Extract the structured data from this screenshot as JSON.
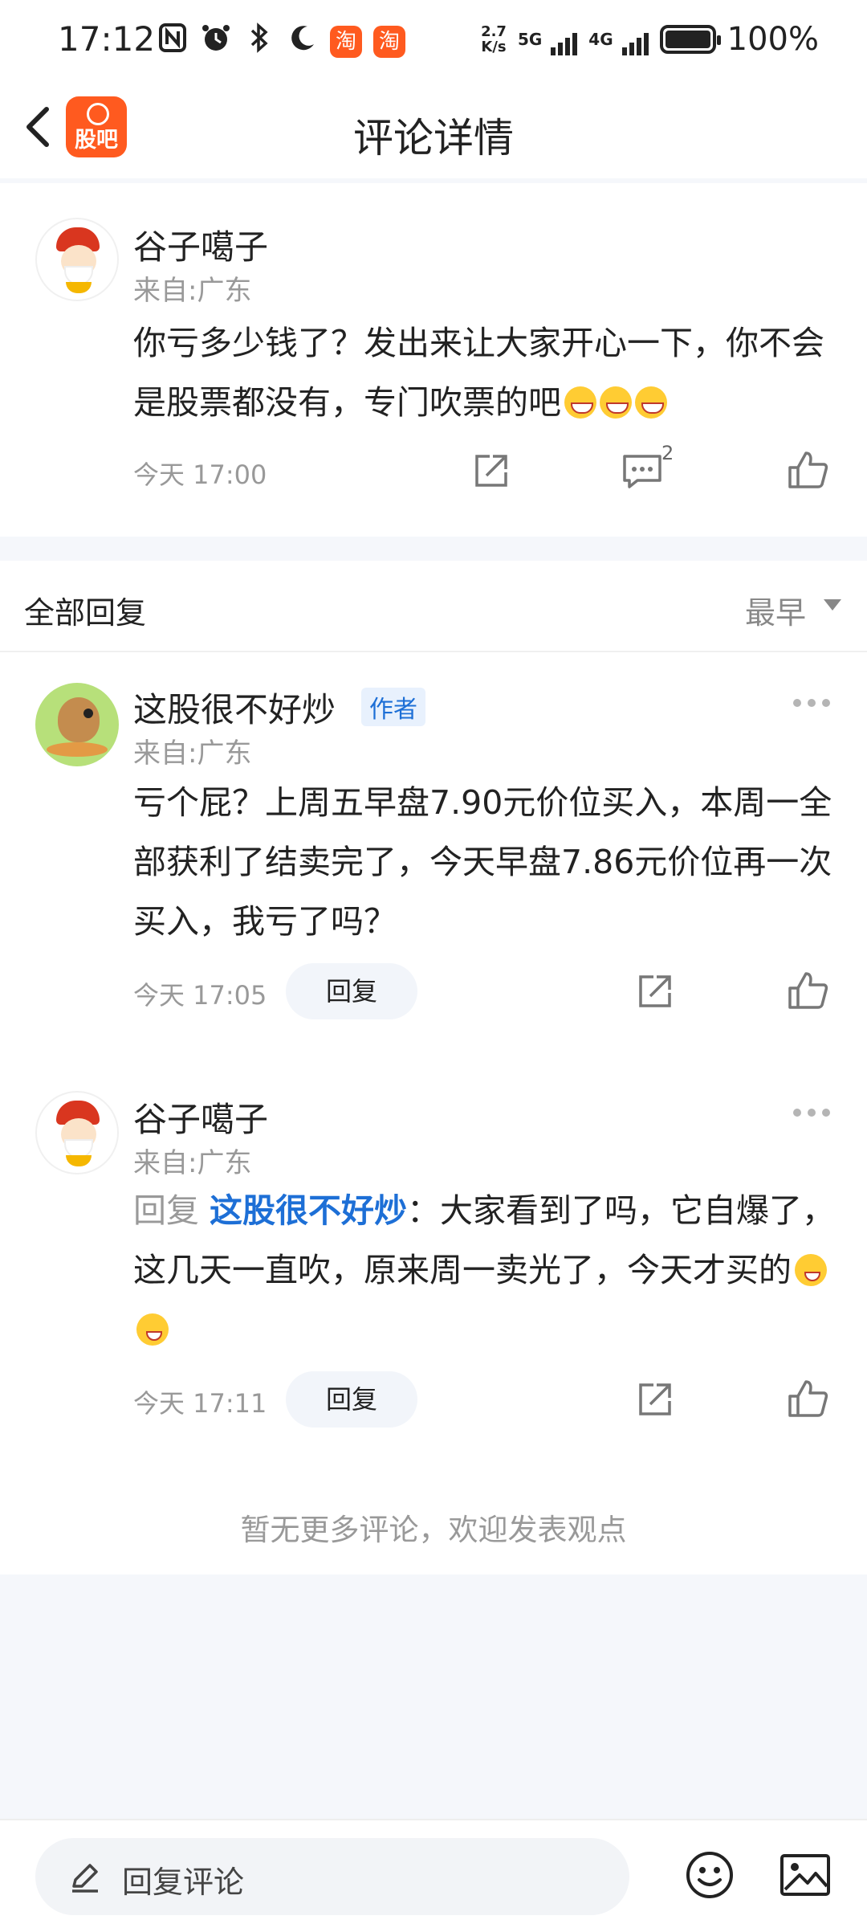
{
  "status_bar": {
    "time": "17:12",
    "icons": [
      "nfc-icon",
      "alarm-icon",
      "bluetooth-icon",
      "moon-icon",
      "taobao-app-icon",
      "taobao-app-icon"
    ],
    "app_glyph": "淘",
    "net_speed_value": "2.7",
    "net_speed_unit": "K/s",
    "network_1": "5G",
    "network_2": "4G",
    "battery_level": 1.0,
    "battery_percent": "100%"
  },
  "nav": {
    "logo_text": "股吧",
    "title": "评论详情"
  },
  "main_comment": {
    "user": "谷子噶子",
    "location": "来自:广东",
    "text": "你亏多少钱了？发出来让大家开心一下，你不会是股票都没有，专门吹票的吧",
    "time": "今天 17:00",
    "comment_count": "2"
  },
  "replies_header": {
    "title": "全部回复",
    "sort": "最早"
  },
  "replies": [
    {
      "user": "这股很不好炒",
      "tag": "作者",
      "location": "来自:广东",
      "text": "亏个屁？上周五早盘7.90元价位买入，本周一全部获利了结卖完了，今天早盘7.86元价位再一次买入，我亏了吗？",
      "time": "今天 17:05",
      "reply_label": "回复"
    },
    {
      "user": "谷子噶子",
      "location": "来自:广东",
      "reply_prefix": "回复 ",
      "reply_target": "这股很不好炒",
      "text": "：大家看到了吗，它自爆了，这几天一直吹，原来周一卖光了，今天才买的",
      "time": "今天 17:11",
      "reply_label": "回复"
    }
  ],
  "end_text": "暂无更多评论，欢迎发表观点",
  "bottom_bar": {
    "placeholder": "回复评论"
  },
  "colors": {
    "accent": "#1d6fd6",
    "brand": "#ff5a1f",
    "background": "#f5f7fb"
  }
}
